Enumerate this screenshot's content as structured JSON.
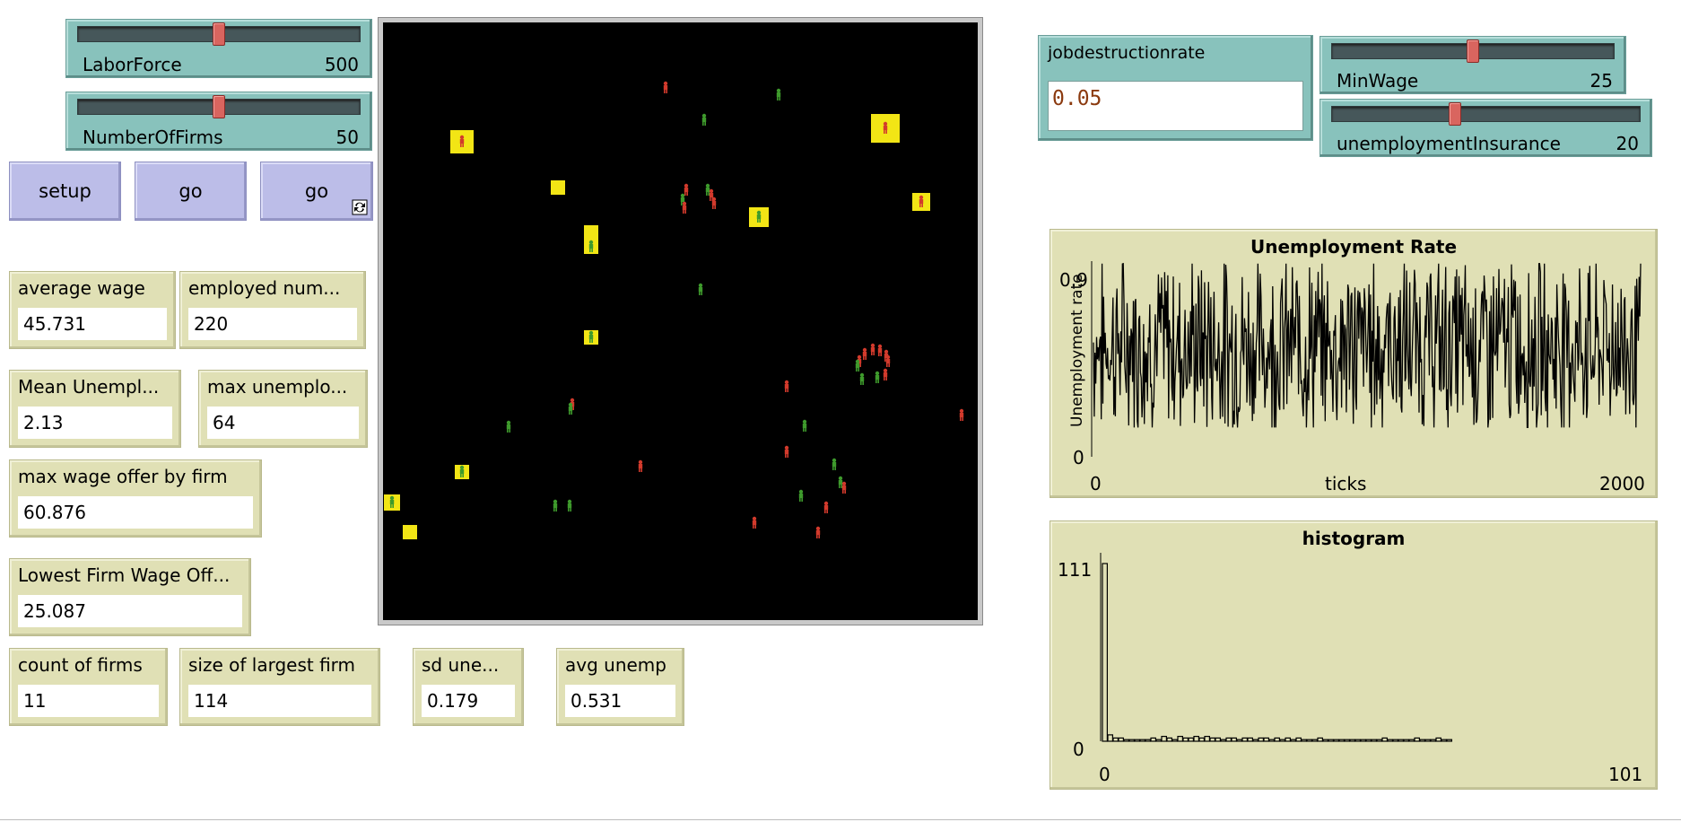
{
  "sliders": {
    "laborforce": {
      "label": "LaborForce",
      "value": "500",
      "position": 0.5
    },
    "numberoffirms": {
      "label": "NumberOfFirms",
      "value": "50",
      "position": 0.5
    },
    "minwage": {
      "label": "MinWage",
      "value": "25",
      "position": 0.5
    },
    "unemploymentinsurance": {
      "label": "unemploymentInsurance",
      "value": "20",
      "position": 0.4
    }
  },
  "buttons": {
    "setup": "setup",
    "go_once": "go",
    "go_forever": "go",
    "forever_icon": "forever-icon"
  },
  "monitors": {
    "average_wage": {
      "label": "average wage",
      "value": "45.731"
    },
    "employed_num": {
      "label": "employed num...",
      "value": "220"
    },
    "mean_unempl": {
      "label": "Mean Unempl...",
      "value": "2.13"
    },
    "max_unemplo": {
      "label": "max unemplo...",
      "value": "64"
    },
    "max_wage_offer": {
      "label": "max wage offer by firm",
      "value": "60.876"
    },
    "lowest_firm_wage": {
      "label": "Lowest Firm Wage Off...",
      "value": "25.087"
    },
    "count_of_firms": {
      "label": "count of firms",
      "value": "11"
    },
    "size_of_largest_firm": {
      "label": "size of largest firm",
      "value": "114"
    },
    "sd_une": {
      "label": "sd une...",
      "value": "0.179"
    },
    "avg_unemp": {
      "label": "avg unemp",
      "value": "0.531"
    }
  },
  "input": {
    "label": "jobdestructionrate",
    "value": "0.05"
  },
  "colors": {
    "employed": "#3e9a2c",
    "unemployed": "#d23a2c",
    "firm": "#f2e515",
    "world_bg": "#000000"
  },
  "chart_data": [
    {
      "type": "line",
      "title": "Unemployment Rate",
      "xlabel": "ticks",
      "ylabel": "Unemployment rate",
      "xlim": [
        0,
        2000
      ],
      "ylim": [
        0,
        0.9
      ],
      "x_tick_labels": [
        "0",
        "2000"
      ],
      "y_tick_labels": [
        "0",
        "0.9"
      ],
      "series": [
        {
          "values_summary": "noisy signal oscillating between about 0.05 and 1.0, mean approx 0.53",
          "mean": 0.53,
          "min": 0.05,
          "max": 1.0
        }
      ],
      "grid": false
    },
    {
      "type": "bar",
      "title": "histogram",
      "xlim": [
        0,
        101
      ],
      "ylim": [
        0,
        111
      ],
      "x_tick_labels": [
        "0",
        "101"
      ],
      "y_tick_labels": [
        "0",
        "111"
      ],
      "categories": [
        0,
        1,
        2,
        3,
        4,
        5,
        6,
        7,
        8,
        9,
        10,
        11,
        12,
        13,
        14,
        15,
        16,
        17,
        18,
        19,
        20,
        21,
        22,
        23,
        24,
        25,
        26,
        27,
        28,
        29,
        30,
        31,
        32,
        33,
        34,
        35,
        36,
        37,
        38,
        39,
        40,
        41,
        42,
        43,
        44,
        45,
        46,
        47,
        48,
        49,
        50,
        51,
        52,
        53,
        54,
        55,
        56,
        57,
        58,
        59,
        60,
        61,
        62,
        63,
        64
      ],
      "values": [
        111,
        4,
        2,
        2,
        1,
        1,
        1,
        1,
        1,
        2,
        1,
        3,
        2,
        1,
        3,
        2,
        2,
        3,
        2,
        3,
        2,
        2,
        1,
        2,
        2,
        1,
        2,
        2,
        1,
        2,
        2,
        1,
        2,
        1,
        2,
        1,
        2,
        1,
        1,
        1,
        2,
        1,
        1,
        1,
        1,
        1,
        1,
        1,
        1,
        1,
        1,
        1,
        2,
        1,
        1,
        1,
        1,
        1,
        2,
        1,
        1,
        1,
        2,
        1,
        1
      ],
      "grid": false
    }
  ]
}
